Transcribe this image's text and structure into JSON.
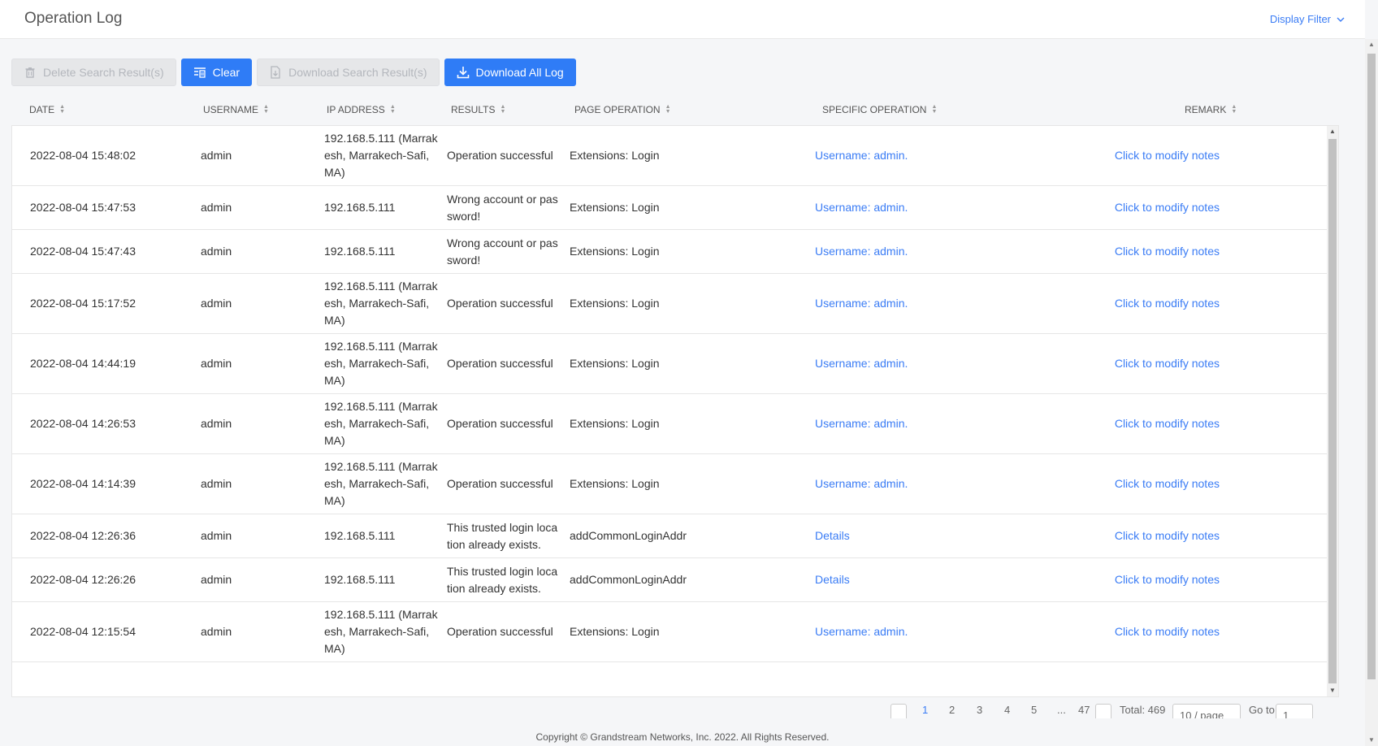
{
  "header": {
    "title": "Operation Log",
    "display_filter": "Display Filter"
  },
  "toolbar": {
    "delete_label": "Delete Search Result(s)",
    "clear_label": "Clear",
    "download_search_label": "Download Search Result(s)",
    "download_all_label": "Download All Log"
  },
  "columns": {
    "date": "DATE",
    "username": "USERNAME",
    "ip": "IP ADDRESS",
    "results": "RESULTS",
    "page_operation": "PAGE OPERATION",
    "specific_operation": "SPECIFIC OPERATION",
    "remark": "REMARK"
  },
  "rows": [
    {
      "date": "2022-08-04 15:48:02",
      "username": "admin",
      "ip": "192.168.5.111 (Marrakesh, Marrakech-Safi, MA)",
      "result": "Operation successful",
      "page_op": "Extensions: Login",
      "specific_op": "Username: admin.",
      "remark": "Click to modify notes"
    },
    {
      "date": "2022-08-04 15:47:53",
      "username": "admin",
      "ip": "192.168.5.111",
      "result": "Wrong account or password!",
      "page_op": "Extensions: Login",
      "specific_op": "Username: admin.",
      "remark": "Click to modify notes"
    },
    {
      "date": "2022-08-04 15:47:43",
      "username": "admin",
      "ip": "192.168.5.111",
      "result": "Wrong account or password!",
      "page_op": "Extensions: Login",
      "specific_op": "Username: admin.",
      "remark": "Click to modify notes"
    },
    {
      "date": "2022-08-04 15:17:52",
      "username": "admin",
      "ip": "192.168.5.111 (Marrakesh, Marrakech-Safi, MA)",
      "result": "Operation successful",
      "page_op": "Extensions: Login",
      "specific_op": "Username: admin.",
      "remark": "Click to modify notes"
    },
    {
      "date": "2022-08-04 14:44:19",
      "username": "admin",
      "ip": "192.168.5.111 (Marrakesh, Marrakech-Safi, MA)",
      "result": "Operation successful",
      "page_op": "Extensions: Login",
      "specific_op": "Username: admin.",
      "remark": "Click to modify notes"
    },
    {
      "date": "2022-08-04 14:26:53",
      "username": "admin",
      "ip": "192.168.5.111 (Marrakesh, Marrakech-Safi, MA)",
      "result": "Operation successful",
      "page_op": "Extensions: Login",
      "specific_op": "Username: admin.",
      "remark": "Click to modify notes"
    },
    {
      "date": "2022-08-04 14:14:39",
      "username": "admin",
      "ip": "192.168.5.111 (Marrakesh, Marrakech-Safi, MA)",
      "result": "Operation successful",
      "page_op": "Extensions: Login",
      "specific_op": "Username: admin.",
      "remark": "Click to modify notes"
    },
    {
      "date": "2022-08-04 12:26:36",
      "username": "admin",
      "ip": "192.168.5.111",
      "result": "This trusted login location already exists.",
      "page_op": "addCommonLoginAddr",
      "specific_op": "Details",
      "remark": "Click to modify notes"
    },
    {
      "date": "2022-08-04 12:26:26",
      "username": "admin",
      "ip": "192.168.5.111",
      "result": "This trusted login location already exists.",
      "page_op": "addCommonLoginAddr",
      "specific_op": "Details",
      "remark": "Click to modify notes"
    },
    {
      "date": "2022-08-04 12:15:54",
      "username": "admin",
      "ip": "192.168.5.111 (Marrakesh, Marrakech-Safi, MA)",
      "result": "Operation successful",
      "page_op": "Extensions: Login",
      "specific_op": "Username: admin.",
      "remark": "Click to modify notes"
    }
  ],
  "pagination": {
    "pages": [
      "1",
      "2",
      "3",
      "4",
      "5",
      "...",
      "47"
    ],
    "current": "1",
    "total": "Total: 469",
    "page_size": "10 / page",
    "goto_label": "Go to",
    "goto_value": "1"
  },
  "footer": {
    "copyright": "Copyright © Grandstream Networks, Inc. 2022. All Rights Reserved."
  },
  "colors": {
    "primary": "#2f7cf6",
    "link": "#3a7cf5"
  }
}
